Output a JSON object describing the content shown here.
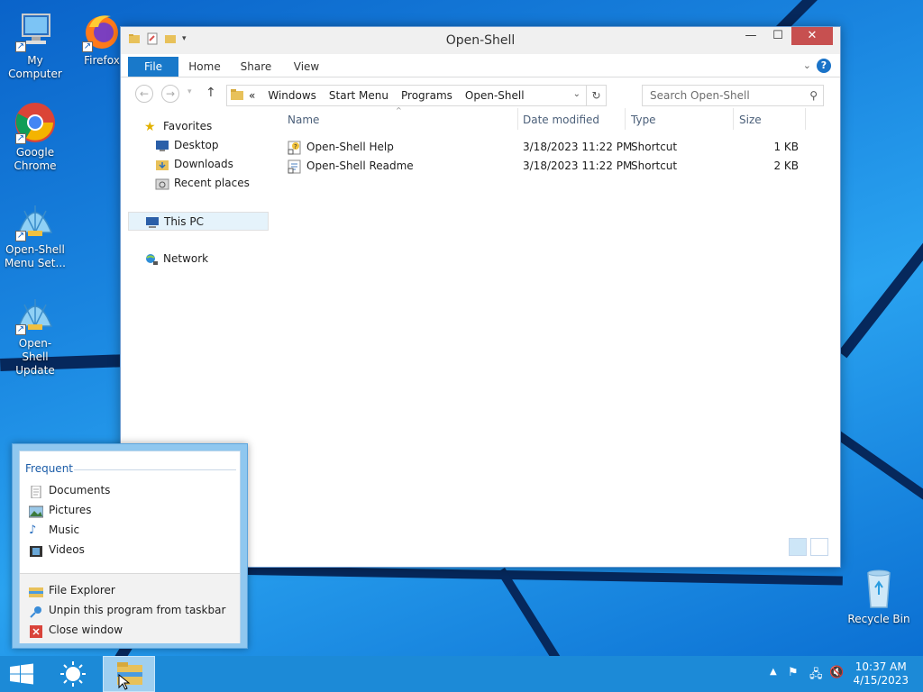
{
  "desktop": {
    "icons": [
      {
        "name": "my-computer",
        "label": "My Computer"
      },
      {
        "name": "firefox",
        "label": "Firefox"
      },
      {
        "name": "google-chrome",
        "label": "Google Chrome"
      },
      {
        "name": "open-shell-menu-settings",
        "label": "Open-Shell Menu Set..."
      },
      {
        "name": "open-shell-update",
        "label": "Open-Shell Update"
      },
      {
        "name": "recycle-bin",
        "label": "Recycle Bin"
      }
    ]
  },
  "window": {
    "title": "Open-Shell",
    "controls": {
      "minimize": "—",
      "maximize": "☐",
      "close": "✕"
    },
    "ribbon_tabs": [
      "File",
      "Home",
      "Share",
      "View"
    ],
    "address": {
      "overflow": "«",
      "crumbs": [
        "Windows",
        "Start Menu",
        "Programs",
        "Open-Shell"
      ]
    },
    "search_placeholder": "Search Open-Shell",
    "nav": {
      "favorites": "Favorites",
      "desktop": "Desktop",
      "downloads": "Downloads",
      "recent_places": "Recent places",
      "this_pc": "This PC",
      "network": "Network"
    },
    "columns": {
      "name": "Name",
      "date": "Date modified",
      "type": "Type",
      "size": "Size"
    },
    "files": [
      {
        "name": "Open-Shell Help",
        "date": "3/18/2023 11:22 PM",
        "type": "Shortcut",
        "size": "1 KB"
      },
      {
        "name": "Open-Shell Readme",
        "date": "3/18/2023 11:22 PM",
        "type": "Shortcut",
        "size": "2 KB"
      }
    ]
  },
  "jumplist": {
    "header": "Frequent",
    "frequent": [
      "Documents",
      "Pictures",
      "Music",
      "Videos"
    ],
    "tasks": [
      "File Explorer",
      "Unpin this program from taskbar",
      "Close window"
    ]
  },
  "taskbar": {
    "time": "10:37 AM",
    "date": "4/15/2023"
  },
  "colors": {
    "accent": "#1979ca",
    "taskbar": "#1c8ad7",
    "close": "#c75050"
  }
}
